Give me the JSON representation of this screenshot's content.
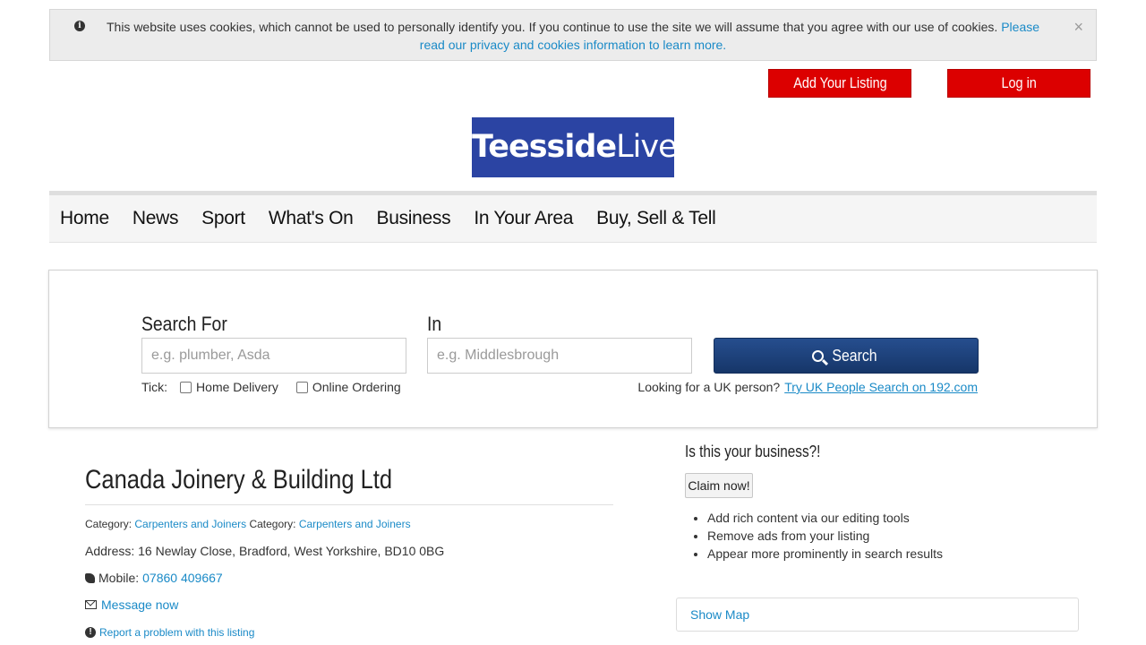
{
  "cookie_banner": {
    "message": "This website uses cookies, which cannot be used to personally identify you. If you continue to use the site we will assume that you agree with our use of cookies.",
    "link_text": "Please read our privacy and cookies information to learn more.",
    "close_symbol": "×"
  },
  "header": {
    "add_listing_label": "Add Your Listing",
    "login_label": "Log in",
    "logo_bold": "Teesside",
    "logo_light": "Live"
  },
  "nav": {
    "items": [
      "Home",
      "News",
      "Sport",
      "What's On",
      "Business",
      "In Your Area",
      "Buy, Sell & Tell"
    ]
  },
  "search": {
    "search_for_label": "Search For",
    "search_for_placeholder": "e.g. plumber, Asda",
    "in_label": "In",
    "in_placeholder": "e.g. Middlesbrough",
    "button_label": "Search",
    "tick_label": "Tick:",
    "home_delivery_label": "Home Delivery",
    "online_ordering_label": "Online Ordering",
    "uk_person_text": "Looking for a UK person?",
    "uk_person_link": "Try UK People Search on 192.com"
  },
  "listing": {
    "name": "Canada Joinery & Building Ltd",
    "category_label_1": "Category:",
    "category_value_1": "Carpenters and Joiners",
    "category_label_2": "Category:",
    "category_value_2": "Carpenters and Joiners",
    "address": "Address: 16 Newlay Close, Bradford, West Yorkshire, BD10 0BG",
    "mobile_label": "Mobile:",
    "mobile_number": "07860 409667",
    "message_link": "Message now",
    "report_link": "Report a problem with this listing"
  },
  "sidebar": {
    "claim_heading": "Is this your business?!",
    "claim_button": "Claim now!",
    "benefits": [
      "Add rich content via our editing tools",
      "Remove ads from your listing",
      "Appear more prominently in search results"
    ],
    "show_map": "Show Map"
  }
}
